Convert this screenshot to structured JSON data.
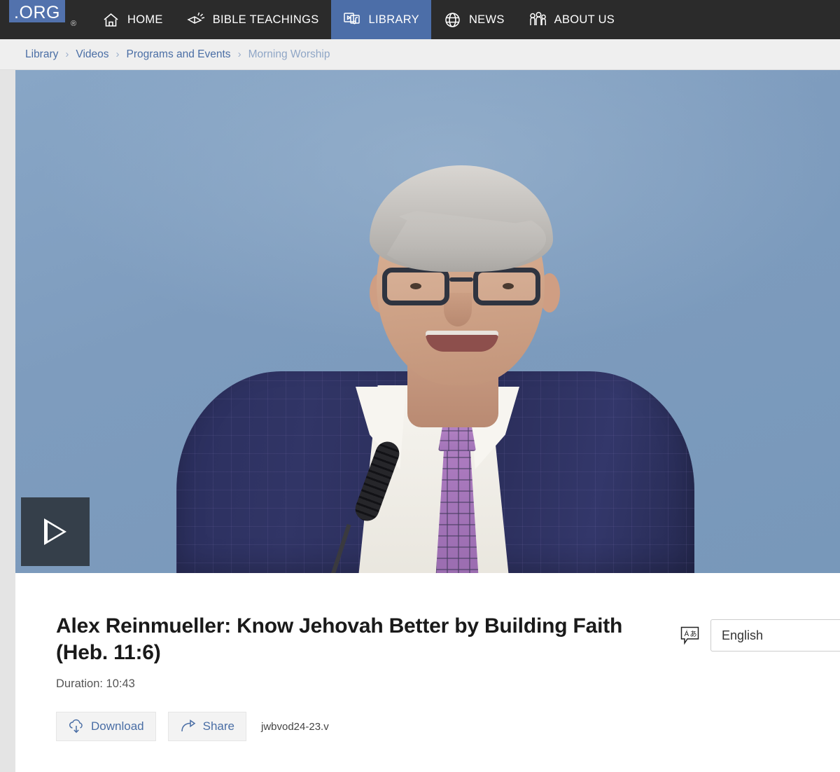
{
  "navbar": {
    "logo_text": ".ORG",
    "registered_mark": "®",
    "items": [
      {
        "label": "HOME",
        "icon": "home-icon",
        "active": false
      },
      {
        "label": "BIBLE TEACHINGS",
        "icon": "open-book-icon",
        "active": false
      },
      {
        "label": "LIBRARY",
        "icon": "media-library-icon",
        "active": true
      },
      {
        "label": "NEWS",
        "icon": "globe-icon",
        "active": false
      },
      {
        "label": "ABOUT US",
        "icon": "people-icon",
        "active": false
      }
    ],
    "background_color": "#2b2b2b",
    "active_color": "#4c6ea8"
  },
  "breadcrumb": {
    "separator": "›",
    "items": [
      {
        "label": "Library",
        "current": false
      },
      {
        "label": "Videos",
        "current": false
      },
      {
        "label": "Programs and Events",
        "current": false
      },
      {
        "label": "Morning Worship",
        "current": true
      }
    ],
    "link_color": "#4a6ea5",
    "current_color": "#8fa6c6"
  },
  "player": {
    "play_button_icon": "play-triangle-icon",
    "poster_description": "Speaker with gray hair and dark glasses in a navy suit, white shirt and purple patterned tie, standing at a microphone holding a Bible, against a blue background"
  },
  "video": {
    "title": "Alex Reinmueller: Know Jehovah Better by Building Faith (Heb. 11:6)",
    "duration_label": "Duration: 10:43",
    "publication_code": "jwbvod24-23.v"
  },
  "language": {
    "icon": "language-bubble-icon",
    "selected": "English",
    "chevron_icon": "chevron-down-icon"
  },
  "actions": {
    "download": {
      "label": "Download",
      "icon": "cloud-download-icon"
    },
    "share": {
      "label": "Share",
      "icon": "share-arrow-icon"
    }
  }
}
